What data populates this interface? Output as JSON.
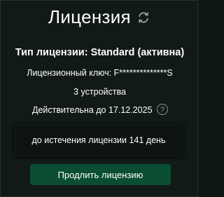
{
  "header": {
    "title": "Лицензия",
    "refresh_icon": "refresh-icon"
  },
  "license": {
    "type_text": "Тип лицензии: Standard (активна)",
    "key_text": "Лицензионный ключ: F**************S",
    "devices_text": "3 устройства",
    "valid_text": "Действительна до 17.12.2025",
    "help_icon": "question-icon",
    "help_glyph": "?"
  },
  "expiry": {
    "text": "до истечения лицензии 141 день"
  },
  "actions": {
    "renew_label": "Продлить лицензию"
  },
  "colors": {
    "background": "#111a17",
    "button": "#0a4d33",
    "text": "#ffffff",
    "muted": "#8e9490"
  }
}
